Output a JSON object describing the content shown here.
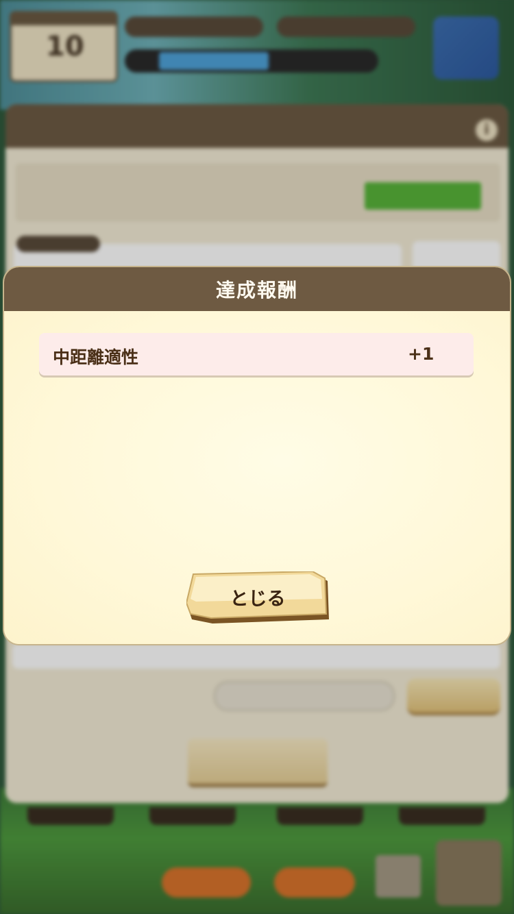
{
  "modal": {
    "title": "達成報酬",
    "rewards": [
      {
        "name": "中距離適性",
        "value": "+1"
      }
    ],
    "close_label": "とじる"
  },
  "background": {
    "turns_remaining": "10"
  },
  "colors": {
    "header_brown": "#6e5a42",
    "modal_cream": "#fff9dc",
    "reward_row_pink": "#fdecea",
    "text_dark_brown": "#4a2f17",
    "button_gold": "#f3dca0"
  }
}
